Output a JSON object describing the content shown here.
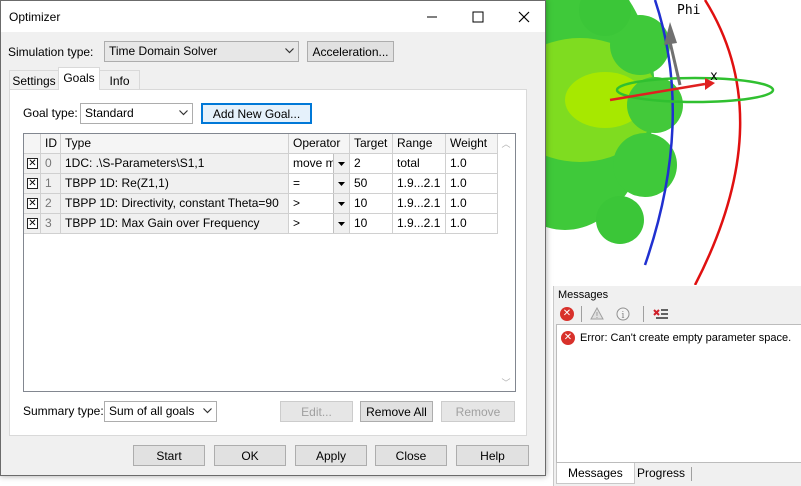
{
  "viewport": {
    "axis_phi": "Phi",
    "axis_x": "x"
  },
  "dialog": {
    "title": "Optimizer",
    "simulation_type_label": "Simulation type:",
    "simulation_type_value": "Time Domain Solver",
    "acceleration_button": "Acceleration...",
    "tabs": [
      {
        "label": "Settings"
      },
      {
        "label": "Goals"
      },
      {
        "label": "Info"
      }
    ],
    "active_tab": "Goals",
    "goal_type_label": "Goal type:",
    "goal_type_value": "Standard",
    "add_new_goal_button": "Add New Goal...",
    "grid": {
      "headers": [
        "",
        "ID",
        "Type",
        "Operator",
        "Target",
        "Range",
        "Weight"
      ],
      "rows": [
        {
          "checked": true,
          "id": "0",
          "type": "1DC: .\\S-Parameters\\S1,1",
          "operator": "move m",
          "target": "2",
          "range": "total",
          "weight": "1.0"
        },
        {
          "checked": true,
          "id": "1",
          "type": "TBPP 1D: Re(Z1,1)",
          "operator": "=",
          "target": "50",
          "range": "1.9...2.1",
          "weight": "1.0"
        },
        {
          "checked": true,
          "id": "2",
          "type": "TBPP 1D: Directivity, constant Theta=90",
          "operator": ">",
          "target": "10",
          "range": "1.9...2.1",
          "weight": "1.0"
        },
        {
          "checked": true,
          "id": "3",
          "type": "TBPP 1D: Max Gain over Frequency",
          "operator": ">",
          "target": "10",
          "range": "1.9...2.1",
          "weight": "1.0"
        }
      ]
    },
    "summary_type_label": "Summary type:",
    "summary_type_value": "Sum of all goals",
    "edit_button": "Edit...",
    "remove_all_button": "Remove All",
    "remove_button": "Remove",
    "bottom_buttons": {
      "start": "Start",
      "ok": "OK",
      "apply": "Apply",
      "close": "Close",
      "help": "Help"
    }
  },
  "messages": {
    "title": "Messages",
    "error_text": "Error: Can't create empty parameter space.",
    "tabs": [
      {
        "label": "Messages"
      },
      {
        "label": "Progress"
      }
    ],
    "active_tab": "Messages"
  },
  "colors": {
    "accent": "#0078d7",
    "error": "#d8312b",
    "phi_axis": "#e01010",
    "theta_axis": "#2030d0",
    "x_axis": "#e02020",
    "equator": "#30c030",
    "pattern": "#40d020"
  }
}
